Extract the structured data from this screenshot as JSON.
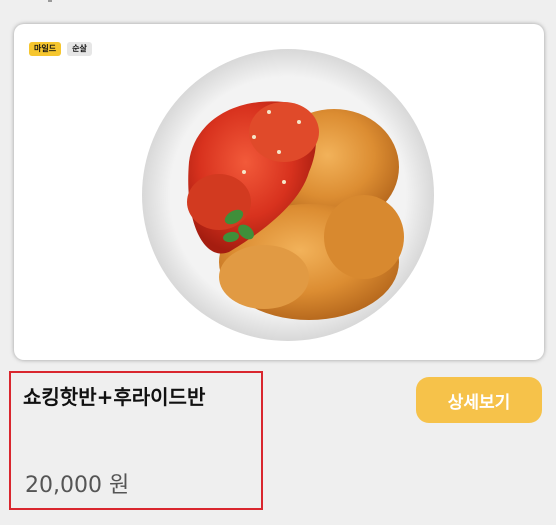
{
  "product": {
    "tags": [
      "마일드",
      "순살"
    ],
    "name": "쇼킹핫반+후라이드반",
    "price": "20,000 원",
    "detail_button_label": "상세보기"
  },
  "colors": {
    "page_background": "#efefef",
    "tag_mild": "#f6c62e",
    "tag_boneless": "#e6e6e6",
    "button": "#f6c24a",
    "highlight_border": "#d9262e"
  },
  "image": {
    "icon": "half-half-chicken-plate-image"
  }
}
